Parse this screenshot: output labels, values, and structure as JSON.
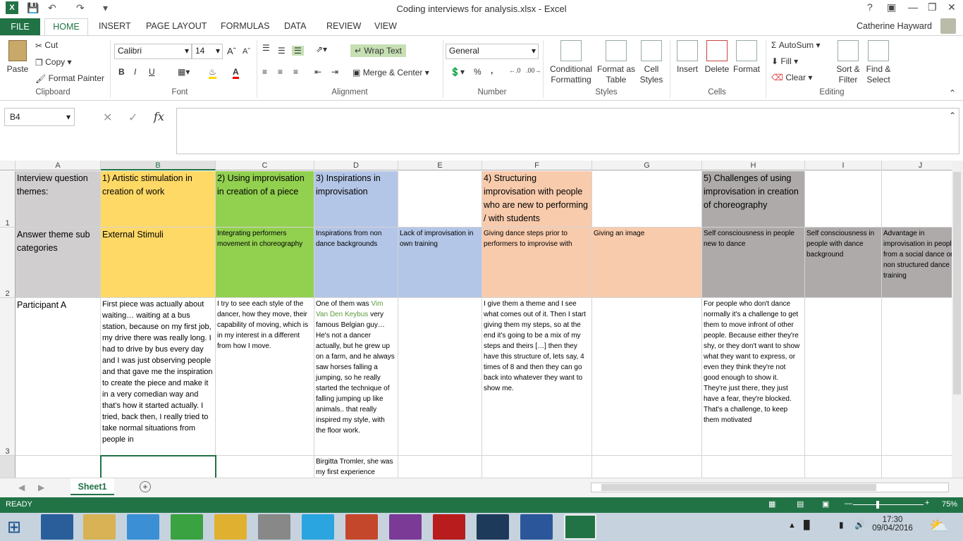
{
  "title": "Coding interviews for analysis.xlsx - Excel",
  "user": "Catherine Hayward",
  "tabs": {
    "file": "FILE",
    "home": "HOME",
    "others": [
      "INSERT",
      "PAGE LAYOUT",
      "FORMULAS",
      "DATA",
      "REVIEW",
      "VIEW"
    ]
  },
  "clipboard": {
    "paste": "Paste",
    "cut": "Cut",
    "copy": "Copy",
    "format_painter": "Format Painter",
    "label": "Clipboard"
  },
  "font": {
    "name": "Calibri",
    "size": "14",
    "label": "Font",
    "b": "B",
    "i": "I",
    "u": "U",
    "a": "A"
  },
  "alignment": {
    "wrap": "Wrap Text",
    "merge": "Merge & Center",
    "label": "Alignment"
  },
  "number": {
    "format": "General",
    "percent": "%",
    "comma": ",",
    "label": "Number"
  },
  "styles": {
    "cond": "Conditional Formatting",
    "fmt_table": "Format as Table",
    "cell": "Cell Styles",
    "label": "Styles"
  },
  "cells": {
    "insert": "Insert",
    "delete": "Delete",
    "format": "Format",
    "label": "Cells"
  },
  "editing": {
    "autosum": "AutoSum",
    "fill": "Fill",
    "clear": "Clear",
    "sort": "Sort & Filter",
    "find": "Find & Select",
    "label": "Editing"
  },
  "formula": {
    "namebox": "B4",
    "fx": "fx",
    "content": ""
  },
  "columns": [
    "A",
    "B",
    "C",
    "D",
    "E",
    "F",
    "G",
    "H",
    "I",
    "J"
  ],
  "rows": [
    "1",
    "2",
    "3"
  ],
  "row1": [
    "Interview question themes:",
    "1) Artistic stimulation in creation of work",
    "2) Using improvisation in creation of a piece",
    "3) Inspirations in improvisation",
    "",
    "4) Structuring improvisation with people who are new to performing / with students",
    "",
    "5) Challenges of using improvisation in creation of choreography",
    "",
    ""
  ],
  "row2": [
    "Answer theme sub categories",
    "External Stimuli",
    "Integrating performers movement in choreography",
    "Inspirations from non dance backgrounds",
    "Lack of improvisation in own training",
    "Giving dance steps prior to performers to improvise with",
    "Giving an image",
    "Self consciousness in people new to dance",
    "Self consciousness in people with dance background",
    "Advantage in improvisation in people from a social dance or non structured dance training"
  ],
  "row3": {
    "a": "Participant A",
    "b": "First piece was actually about waiting… waiting at a bus station, because on my first job, my drive there was really long. I had to drive by bus every day and I was just observing people and that gave me the inspiration to create the piece and make it in a very comedian way and that's how it started actually.  I tried, back then, I really tried to take normal situations from people in",
    "c": "I try to see each style of the dancer, how they move, their capability of moving, which is in my interest in a different from how I move.",
    "d_pre": "One of them was ",
    "d_link": "Vim Van Den Keybus",
    "d_post": " very famous Belgian guy… He's not a dancer actually, but he grew up on a farm, and he always saw horses falling a jumping, so he really started the technique of falling jumping up like animals.. that really inspired my style, with the floor work.",
    "f": "I give them a theme and I see what comes out of it. Then I start giving them my steps, so at the end it's going to be a mix of my steps and theirs […] then they have this structure of, lets say, 4 times of 8 and then they can go back into whatever they want to show me.",
    "h": "For people who don't dance normally it's a challenge to get them to move infront of other people.   Because either they're shy, or they don't want to show what they want to express, or even they think they're not good enough to show it.  They're just there, they just have a fear, they're blocked.  That's a challenge, to keep them motivated"
  },
  "row4": {
    "d": "Birgitta Tromler, she was my first experience"
  },
  "sheet": "Sheet1",
  "status": {
    "ready": "READY",
    "zoom": "75%"
  },
  "clock": {
    "time": "17:30",
    "date": "09/04/2016"
  },
  "colors": {
    "accent": "#217346",
    "yellow": "#ffd966",
    "green": "#92d050",
    "blue": "#b4c6e7",
    "orange": "#f8cbad",
    "gray": "#aeaaaa"
  }
}
